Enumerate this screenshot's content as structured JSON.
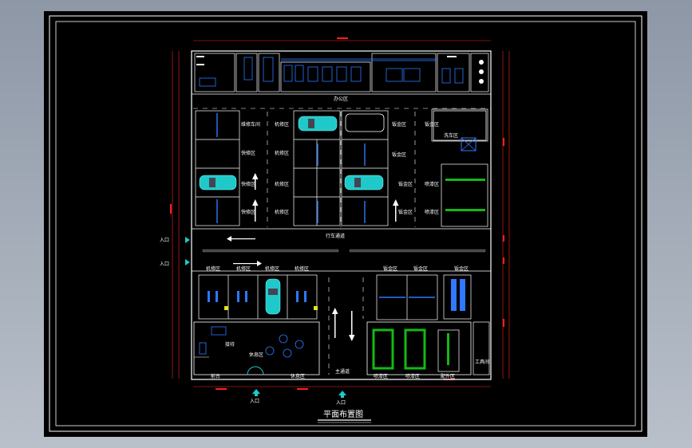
{
  "drawing": {
    "title": "平面布置图",
    "labels": {
      "office_area": "办公区",
      "main_aisle": "行车通道",
      "main_passage": "主通道",
      "entrance": "入口",
      "reception": "接待",
      "lounge": "休息区",
      "front_desk": "前台",
      "wash_area": "洗车区",
      "parts_area": "配件区",
      "machine_area": "机修区",
      "paint_area": "喷漆区",
      "sheet_area": "钣金区",
      "quick_area": "快修区",
      "tool_room": "工具间",
      "repair_workshop": "维修车间"
    }
  },
  "colors": {
    "background": "#000000",
    "linework": "#ffffff",
    "accent_cyan": "#1fc9c9",
    "accent_blue": "#2f78ff",
    "accent_green": "#14b814",
    "accent_yellow": "#e5e51a",
    "dimension_red": "#ff2020"
  }
}
